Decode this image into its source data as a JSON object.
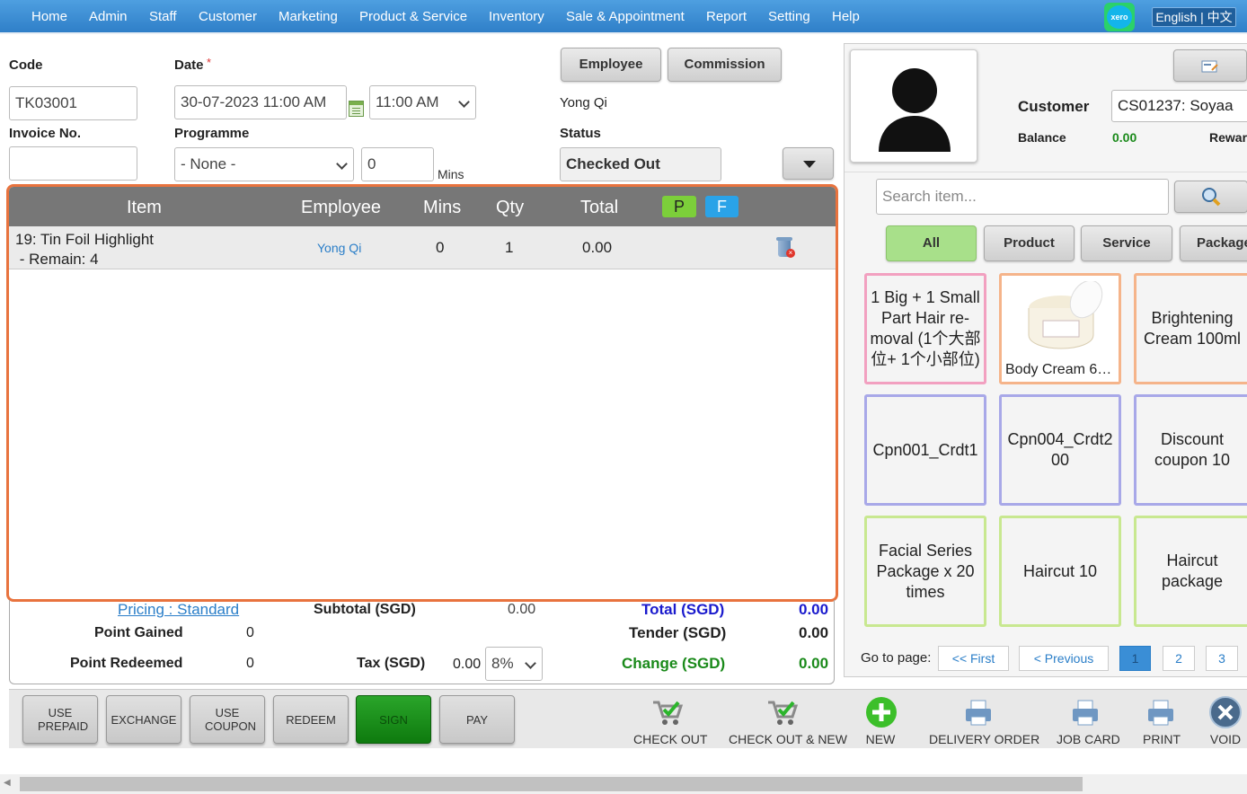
{
  "nav": {
    "items": [
      "Home",
      "Admin",
      "Staff",
      "Customer",
      "Marketing",
      "Product & Service",
      "Inventory",
      "Sale & Appointment",
      "Report",
      "Setting",
      "Help"
    ],
    "xero": "xero",
    "language": "English | 中文"
  },
  "form": {
    "code_label": "Code",
    "code_value": "TK03001",
    "date_label": "Date",
    "required_mark": "*",
    "date_value": "30-07-2023 11:00 AM",
    "time_value": "11:00 AM",
    "invoice_label": "Invoice No.",
    "invoice_value": "",
    "programme_label": "Programme",
    "programme_value": "- None -",
    "mins_value": "0",
    "mins_label": "Mins",
    "employee_button": "Employee",
    "commission_button": "Commission",
    "employee_name": "Yong Qi",
    "status_label": "Status",
    "status_value": "Checked Out"
  },
  "table": {
    "headers": {
      "item": "Item",
      "employee": "Employee",
      "mins": "Mins",
      "qty": "Qty",
      "total": "Total",
      "p": "P",
      "f": "F"
    },
    "rows": [
      {
        "item": "19: Tin Foil Highlight",
        "remain": " - Remain: 4",
        "employee": "Yong Qi",
        "mins": "0",
        "qty": "1",
        "total": "0.00"
      }
    ]
  },
  "totals": {
    "pricing": "Pricing : Standard",
    "subtotal_label": "Subtotal (SGD)",
    "subtotal_value": "0.00",
    "total_label": "Total (SGD)",
    "total_value": "0.00",
    "point_gained_label": "Point Gained",
    "point_gained_value": "0",
    "tender_label": "Tender (SGD)",
    "tender_value": "0.00",
    "point_redeemed_label": "Point Redeemed",
    "point_redeemed_value": "0",
    "tax_label": "Tax (SGD)",
    "tax_value": "0.00",
    "tax_rate": "8%",
    "change_label": "Change (SGD)",
    "change_value": "0.00"
  },
  "actions": {
    "buttons": [
      "USE PREPAID",
      "EXCHANGE",
      "USE COUPON",
      "REDEEM",
      "SIGN",
      "PAY"
    ],
    "icons": [
      "CHECK OUT",
      "CHECK OUT & NEW",
      "NEW",
      "DELIVERY ORDER",
      "JOB CARD",
      "PRINT",
      "VOID"
    ]
  },
  "customer": {
    "label": "Customer",
    "value": "CS01237: Soyaa",
    "balance_label": "Balance",
    "balance_value": "0.00",
    "reward_label": "Rewar"
  },
  "search": {
    "placeholder": "Search item..."
  },
  "filters": [
    "All",
    "Product",
    "Service",
    "Package"
  ],
  "tiles": [
    "1 Big + 1 Small Part Hair re-moval (1个大部位+ 1个小部位)",
    "Body Cream 6…",
    "Brightening Cream 100ml",
    "Cpn001_Crdt1",
    "Cpn004_Crdt200",
    "Discount coupon 10",
    "Facial Series Package x 20 times",
    "Haircut 10",
    "Haircut package"
  ],
  "pagination": {
    "label": "Go to page:",
    "first": "<< First",
    "previous": "< Previous",
    "pages": [
      "1",
      "2",
      "3"
    ]
  },
  "colors": {
    "accent": "#2f7fc8",
    "panel_border": "#e8733e",
    "p_badge": "#7ccf3a",
    "f_badge": "#2aa3e8",
    "sign": "#1f8f1f",
    "total_blue": "#1a1acd",
    "change_green": "#1a8a1a"
  }
}
